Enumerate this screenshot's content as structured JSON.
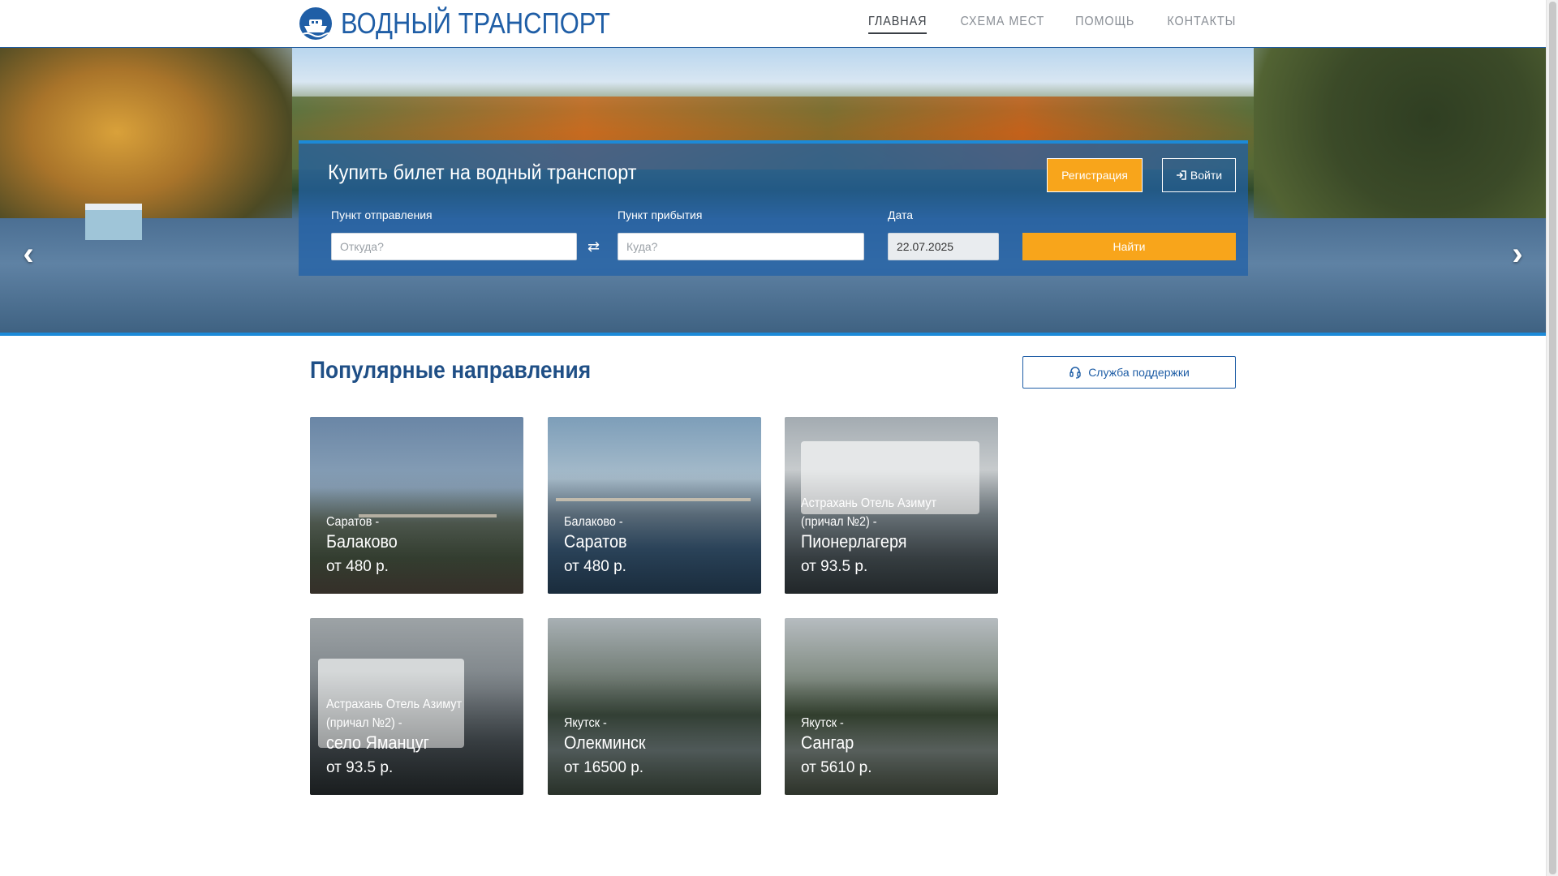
{
  "header": {
    "logo_text": "ВОДНЫЙ ТРАНСПОРТ",
    "nav": [
      {
        "label": "ГЛАВНАЯ",
        "active": true
      },
      {
        "label": "СХЕМА МЕСТ",
        "active": false
      },
      {
        "label": "ПОМОЩЬ",
        "active": false
      },
      {
        "label": "КОНТАКТЫ",
        "active": false
      }
    ]
  },
  "hero": {
    "prev_arrow": "‹",
    "next_arrow": "›",
    "search": {
      "title": "Купить билет на водный транспорт",
      "register_label": "Регистрация",
      "login_label": "Войти",
      "departure_label": "Пункт отправления",
      "departure_placeholder": "Откуда?",
      "arrival_label": "Пункт прибытия",
      "arrival_placeholder": "Куда?",
      "date_label": "Дата",
      "date_value": "22.07.2025",
      "find_label": "Найти",
      "swap_icon": "⇄"
    }
  },
  "main": {
    "section_title": "Популярные направления",
    "support_label": "Служба поддержки",
    "cards": [
      {
        "from": "Саратов -",
        "to": "Балаково",
        "price": "от 480 р."
      },
      {
        "from": "Балаково -",
        "to": "Саратов",
        "price": "от 480 р."
      },
      {
        "from": "Астрахань Отель Азимут (причал №2) -",
        "to": "Пионерлагеря",
        "price": "от 93.5 р."
      },
      {
        "from": "Астрахань Отель Азимут (причал №2) -",
        "to": "село Яманцуг",
        "price": "от 93.5 р."
      },
      {
        "from": "Якутск -",
        "to": "Олекминск",
        "price": "от 16500 р."
      },
      {
        "from": "Якутск -",
        "to": "Сангар",
        "price": "от 5610 р."
      }
    ]
  },
  "colors": {
    "brand_blue": "#1f5ea6",
    "accent_orange": "#f8a51b",
    "hero_line": "#1c8ad8"
  }
}
